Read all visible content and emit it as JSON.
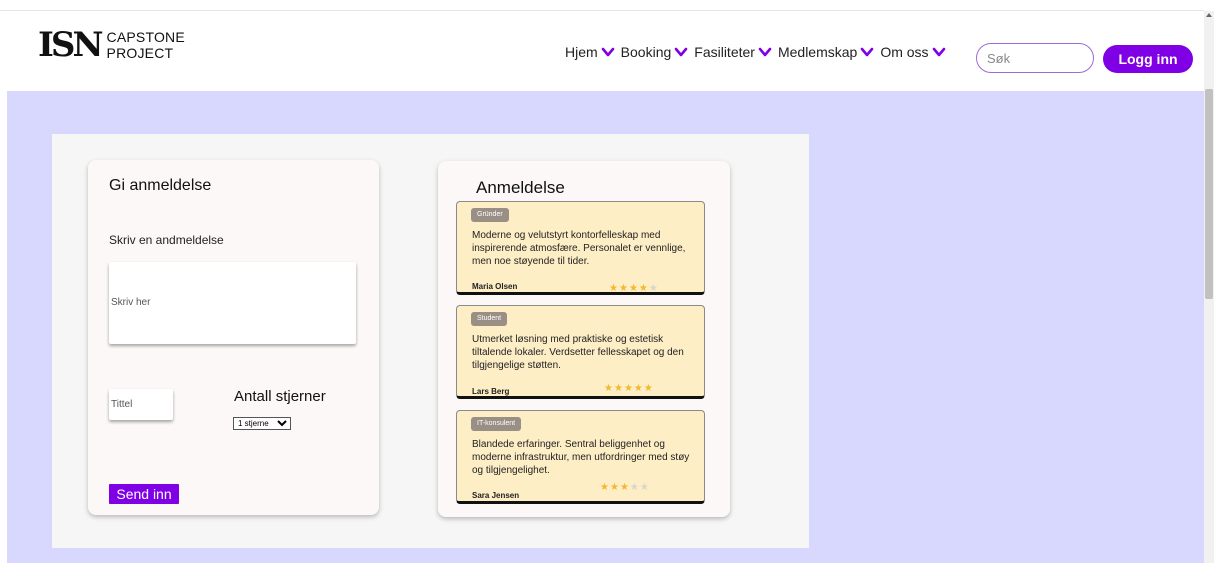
{
  "brand": {
    "mark": "ISN",
    "line1": "CAPSTONE",
    "line2": "PROJECT"
  },
  "nav": {
    "items": [
      {
        "label": "Hjem"
      },
      {
        "label": "Booking"
      },
      {
        "label": "Fasiliteter"
      },
      {
        "label": "Medlemskap"
      },
      {
        "label": "Om oss"
      }
    ],
    "search_placeholder": "Søk",
    "login_label": "Logg inn"
  },
  "colors": {
    "accent": "#8000e6",
    "background": "#d8d8ff",
    "review_card": "#feeec6",
    "star": "#f2b92c"
  },
  "form": {
    "title": "Gi anmeldelse",
    "subtitle": "Skriv en andmeldelse",
    "text_placeholder": "Skriv her",
    "title_placeholder": "Tittel",
    "stars_label": "Antall stjerner",
    "stars_selected": "1 stjerne",
    "submit_label": "Send inn"
  },
  "reviews": {
    "title": "Anmeldelse",
    "items": [
      {
        "badge": "Gründer",
        "text": "Moderne og velutstyrt kontorfelleskap med inspirerende atmosfære. Personalet er vennlige, men noe støyende til tider.",
        "name": "Maria Olsen",
        "rating": 4,
        "max": 5
      },
      {
        "badge": "Student",
        "text": "Utmerket løsning med praktiske og estetisk tiltalende lokaler. Verdsetter fellesskapet og den tilgjengelige støtten.",
        "name": "Lars Berg",
        "rating": 5,
        "max": 5
      },
      {
        "badge": "IT-konsulent",
        "text": "Blandede erfaringer. Sentral beliggenhet og moderne infrastruktur, men utfordringer med støy og tilgjengelighet.",
        "name": "Sara Jensen",
        "rating": 3,
        "max": 5
      }
    ]
  }
}
